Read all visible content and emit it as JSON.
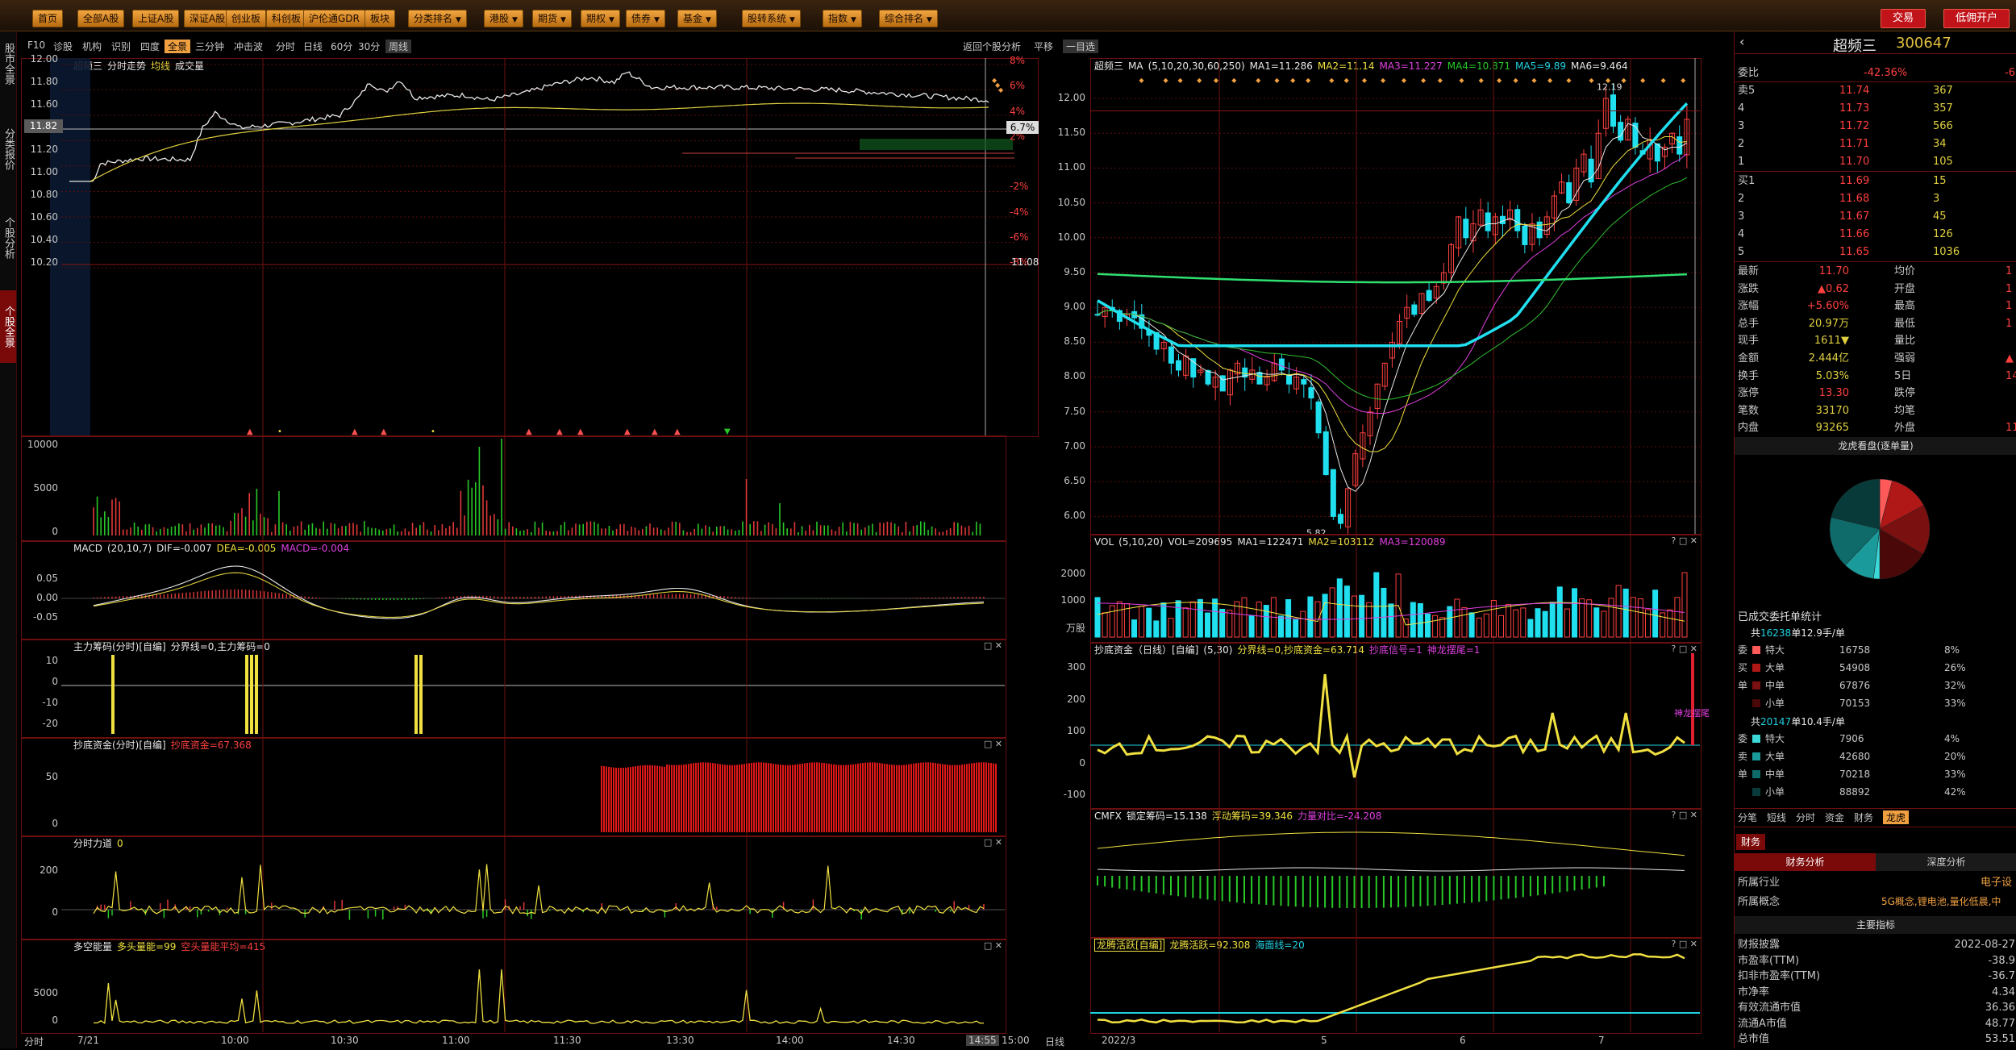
{
  "topbar": {
    "buttons": [
      "首页",
      "全部A股",
      "上证A股",
      "深证A股",
      "创业板",
      "科创板",
      "沪伦通GDR",
      "板块",
      "分类排名",
      "港股",
      "期货",
      "期权",
      "债券",
      "基金",
      "股转系统",
      "指数",
      "综合排名"
    ],
    "trade_label": "交易",
    "margin_label": "低佣开户"
  },
  "subbar": {
    "tabs": [
      "F10",
      "诊股",
      "机构",
      "识别",
      "四度",
      "全景",
      "三分钟",
      "冲击波"
    ],
    "periods": [
      "分时",
      "日线",
      "60分",
      "30分",
      "周线"
    ],
    "right": [
      "返回个股分析",
      "平移",
      "一目选"
    ]
  },
  "leftrail": {
    "tabs": [
      "股市全景",
      "分类报价",
      "个股分析",
      "个股全景"
    ]
  },
  "intraday": {
    "header": [
      "超频三",
      "分时走势",
      "均线",
      "成交量"
    ],
    "price_ticks": [
      "12.00",
      "11.80",
      "11.60",
      "11.40",
      "11.20",
      "11.00",
      "10.80",
      "10.60",
      "10.40",
      "10.20"
    ],
    "pct_ticks": [
      "8%",
      "6%",
      "4%",
      "2%",
      "",
      "-2%",
      "-4%",
      "-6%",
      "-8%"
    ],
    "cur_price_tag": "11.82",
    "cur_pct_tag": "6.7%",
    "prev_close": "11.08",
    "vol_ticks": [
      "10000",
      "5000",
      "0"
    ],
    "macd_header": [
      "MACD",
      "(20,10,7)",
      "DIF=-0.007",
      "DEA=-0.005",
      "MACD=-0.004"
    ],
    "macd_ticks": [
      "0.05",
      "0.00",
      "-0.05"
    ],
    "zl_header": [
      "主力筹码(分时)[自编]",
      "分界线=0,主力筹码=0"
    ],
    "zl_ticks": [
      "10",
      "0",
      "-10",
      "-20"
    ],
    "cd_header": [
      "抄底资金(分时)[自编]",
      "抄底资金=67.368"
    ],
    "cd_ticks": [
      "50",
      "0"
    ],
    "fl_header": [
      "分时力道",
      "0"
    ],
    "fl_ticks": [
      "200",
      "0"
    ],
    "dk_header": [
      "多空能量",
      "多头量能=99",
      "空头量能平均=415"
    ],
    "dk_ticks": [
      "5000",
      "0"
    ],
    "time_axis": [
      "分时",
      "7/21",
      "10:00",
      "10:30",
      "11:00",
      "11:30",
      "13:30",
      "14:00",
      "14:30",
      "14:55",
      "15:00"
    ]
  },
  "daily": {
    "header": [
      "超频三",
      "MA",
      "(5,10,20,30,60,250)",
      "MA1=11.286",
      "MA2=11.14",
      "MA3=11.227",
      "MA4=10.871",
      "MA5=9.89",
      "MA6=9.464"
    ],
    "price_ticks": [
      "12.00",
      "11.50",
      "11.00",
      "10.50",
      "10.00",
      "9.50",
      "9.00",
      "8.50",
      "8.00",
      "7.50",
      "7.00",
      "6.50",
      "6.00"
    ],
    "high_label": "12.19",
    "low_label": "5.82",
    "b_label": "B",
    "vol_header": [
      "VOL",
      "(5,10,20)",
      "VOL=209695",
      "MA1=122471",
      "MA2=103112",
      "MA3=120089"
    ],
    "vol_ticks": [
      "2000",
      "1000",
      "万股"
    ],
    "cd_header": [
      "抄底资金（日线）[自编]",
      "(5,30)",
      "分界线=0,抄底资金=63.714",
      "抄底信号=1",
      "神龙摆尾=1"
    ],
    "cd_ticks": [
      "300",
      "200",
      "100",
      "0",
      "-100"
    ],
    "cd_annot": "神龙摆尾",
    "cmfx_header": [
      "CMFX",
      "锁定筹码=15.138",
      "浮动筹码=39.346",
      "力量对比=-24.208"
    ],
    "lt_header": [
      "龙腾活跃[自编]",
      "龙腾活跃=92.308",
      "海面线=20"
    ],
    "time_axis": [
      "日线",
      "2022/3",
      "5",
      "6",
      "7"
    ]
  },
  "quote": {
    "name": "超频三",
    "code": "300647",
    "weibi_label": "委比",
    "weibi_value": "-42.36%",
    "weibi_right": "-6",
    "asks": [
      {
        "label": "卖5",
        "price": "11.74",
        "vol": "367"
      },
      {
        "label": "4",
        "price": "11.73",
        "vol": "357"
      },
      {
        "label": "3",
        "price": "11.72",
        "vol": "566"
      },
      {
        "label": "2",
        "price": "11.71",
        "vol": "34"
      },
      {
        "label": "1",
        "price": "11.70",
        "vol": "105"
      }
    ],
    "bids": [
      {
        "label": "买1",
        "price": "11.69",
        "vol": "15"
      },
      {
        "label": "2",
        "price": "11.68",
        "vol": "3"
      },
      {
        "label": "3",
        "price": "11.67",
        "vol": "45"
      },
      {
        "label": "4",
        "price": "11.66",
        "vol": "126"
      },
      {
        "label": "5",
        "price": "11.65",
        "vol": "1036"
      }
    ],
    "stats": [
      {
        "l1": "最新",
        "v1": "11.70",
        "l2": "均价",
        "v2": "1"
      },
      {
        "l1": "涨跌",
        "v1": "▲0.62",
        "l2": "开盘",
        "v2": "1"
      },
      {
        "l1": "涨幅",
        "v1": "+5.60%",
        "l2": "最高",
        "v2": "1"
      },
      {
        "l1": "总手",
        "v1": "20.97万",
        "l2": "最低",
        "v2": "1"
      },
      {
        "l1": "现手",
        "v1": "1611▼",
        "l2": "量比",
        "v2": ""
      },
      {
        "l1": "金额",
        "v1": "2.444亿",
        "l2": "强弱",
        "v2": "▲"
      },
      {
        "l1": "换手",
        "v1": "5.03%",
        "l2": "5日",
        "v2": "14."
      },
      {
        "l1": "涨停",
        "v1": "13.30",
        "l2": "跌停",
        "v2": ""
      },
      {
        "l1": "笔数",
        "v1": "33170",
        "l2": "均笔",
        "v2": ""
      },
      {
        "l1": "内盘",
        "v1": "93265",
        "l2": "外盘",
        "v2": "11"
      }
    ],
    "lh_title": "龙虎看盘(逐单量)",
    "pie": [
      {
        "v": 8,
        "c": "#ff5a5a"
      },
      {
        "v": 26,
        "c": "#b01818"
      },
      {
        "v": 32,
        "c": "#7a1010"
      },
      {
        "v": 33,
        "c": "#4a0808"
      },
      {
        "v": 4,
        "c": "#3ad8d8"
      },
      {
        "v": 20,
        "c": "#1a9a9a"
      },
      {
        "v": 33,
        "c": "#0f6a6a"
      },
      {
        "v": 42,
        "c": "#083a3a"
      }
    ],
    "filled_title": "已成交委托单统计",
    "buy_total": [
      "共",
      "16238",
      "单12.9手/单"
    ],
    "buy_rows": [
      {
        "side": "委",
        "type": "特大",
        "vol": "16758",
        "pct": "8%",
        "color": "#ff5a5a"
      },
      {
        "side": "买",
        "type": "大单",
        "vol": "54908",
        "pct": "26%",
        "color": "#b01818"
      },
      {
        "side": "单",
        "type": "中单",
        "vol": "67876",
        "pct": "32%",
        "color": "#7a1010"
      },
      {
        "side": "",
        "type": "小单",
        "vol": "70153",
        "pct": "33%",
        "color": "#4a0808"
      }
    ],
    "sell_total": [
      "共",
      "20147",
      "单10.4手/单"
    ],
    "sell_rows": [
      {
        "side": "委",
        "type": "特大",
        "vol": "7906",
        "pct": "4%",
        "color": "#3ad8d8"
      },
      {
        "side": "卖",
        "type": "大单",
        "vol": "42680",
        "pct": "20%",
        "color": "#1a9a9a"
      },
      {
        "side": "单",
        "type": "中单",
        "vol": "70218",
        "pct": "33%",
        "color": "#0f6a6a"
      },
      {
        "side": "",
        "type": "小单",
        "vol": "88892",
        "pct": "42%",
        "color": "#083a3a"
      }
    ],
    "tabs": [
      "分笔",
      "短线",
      "分时",
      "资金",
      "财务",
      "龙虎"
    ],
    "fin_tab": "财务",
    "fin_subtabs": [
      "财务分析",
      "深度分析"
    ],
    "industry_label": "所属行业",
    "industry_value": "电子设",
    "concept_label": "所属概念",
    "concept_value": "5G概念,锂电池,量化低晨,中",
    "main_idx_title": "主要指标",
    "fin_rows": [
      {
        "l": "财报披露",
        "v": "2022-08-27"
      },
      {
        "l": "市盈率(TTM)",
        "v": "-38.9"
      },
      {
        "l": "扣非市盈率(TTM)",
        "v": "-36.7"
      },
      {
        "l": "市净率",
        "v": "4.34"
      },
      {
        "l": "有效流通市值",
        "v": "36.36"
      },
      {
        "l": "流通A市值",
        "v": "48.77"
      },
      {
        "l": "总市值",
        "v": "53.51"
      }
    ]
  },
  "colors": {
    "up": "#ff4040",
    "down": "#28c828",
    "grid": "#6b0f0f",
    "ma_yellow": "#f0e040",
    "ma_white": "#e8e8e8",
    "ma_magenta": "#e040e0",
    "cyan": "#20e0f0",
    "green_ma": "#30e070"
  }
}
